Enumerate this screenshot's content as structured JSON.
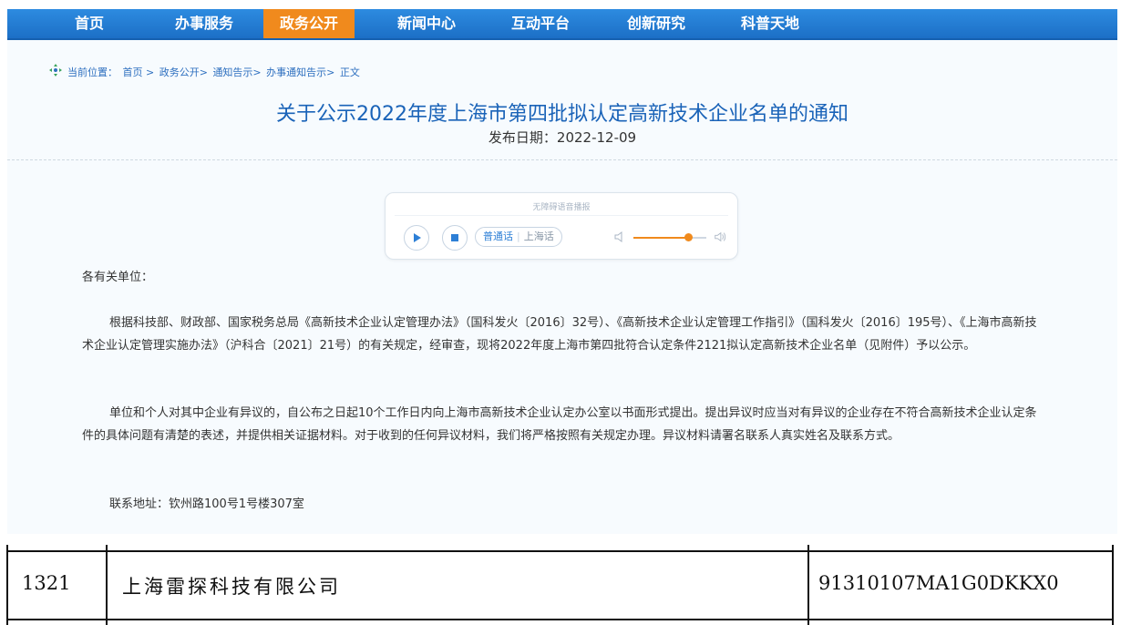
{
  "nav": {
    "items": [
      "首页",
      "办事服务",
      "政务公开",
      "新闻中心",
      "互动平台",
      "创新研究",
      "科普天地"
    ],
    "active_index": 2,
    "colors": {
      "bar": "#1c6fc6",
      "active": "#f08a1d"
    }
  },
  "breadcrumb": {
    "prefix": "当前位置：",
    "items": [
      "首页 >",
      "政务公开>",
      "通知告示>",
      "办事通知告示>",
      "正文"
    ]
  },
  "article": {
    "title": "关于公示2022年度上海市第四批拟认定高新技术企业名单的通知",
    "date": "发布日期：2022-12-09",
    "greeting": "各有关单位：",
    "paragraphs": [
      "根据科技部、财政部、国家税务总局《高新技术企业认定管理办法》（国科发火〔2016〕32号）、《高新技术企业认定管理工作指引》（国科发火〔2016〕195号）、《上海市高新技术企业认定管理实施办法》（沪科合〔2021〕21号）的有关规定，经审查，现将2022年度上海市第四批符合认定条件2121拟认定高新技术企业名单（见附件）予以公示。",
      "单位和个人对其中企业有异议的，自公布之日起10个工作日内向上海市高新技术企业认定办公室以书面形式提出。提出异议时应当对有异议的企业存在不符合高新技术企业认定条件的具体问题有清楚的表述，并提供相关证据材料。对于收到的任何异议材料，我们将严格按照有关规定办理。异议材料请署名联系人真实姓名及联系方式。",
      "联系地址：钦州路100号1号楼307室"
    ]
  },
  "player": {
    "label": "无障碍语音播报",
    "lang_active": "普通话",
    "lang_other": "上海话",
    "volume_fraction": 0.75,
    "icons": [
      "play-icon",
      "stop-icon",
      "volume-low-icon",
      "volume-high-icon"
    ]
  },
  "table_row": {
    "index": "1321",
    "company": "上海雷探科技有限公司",
    "code": "91310107MA1G0DKKX0"
  }
}
